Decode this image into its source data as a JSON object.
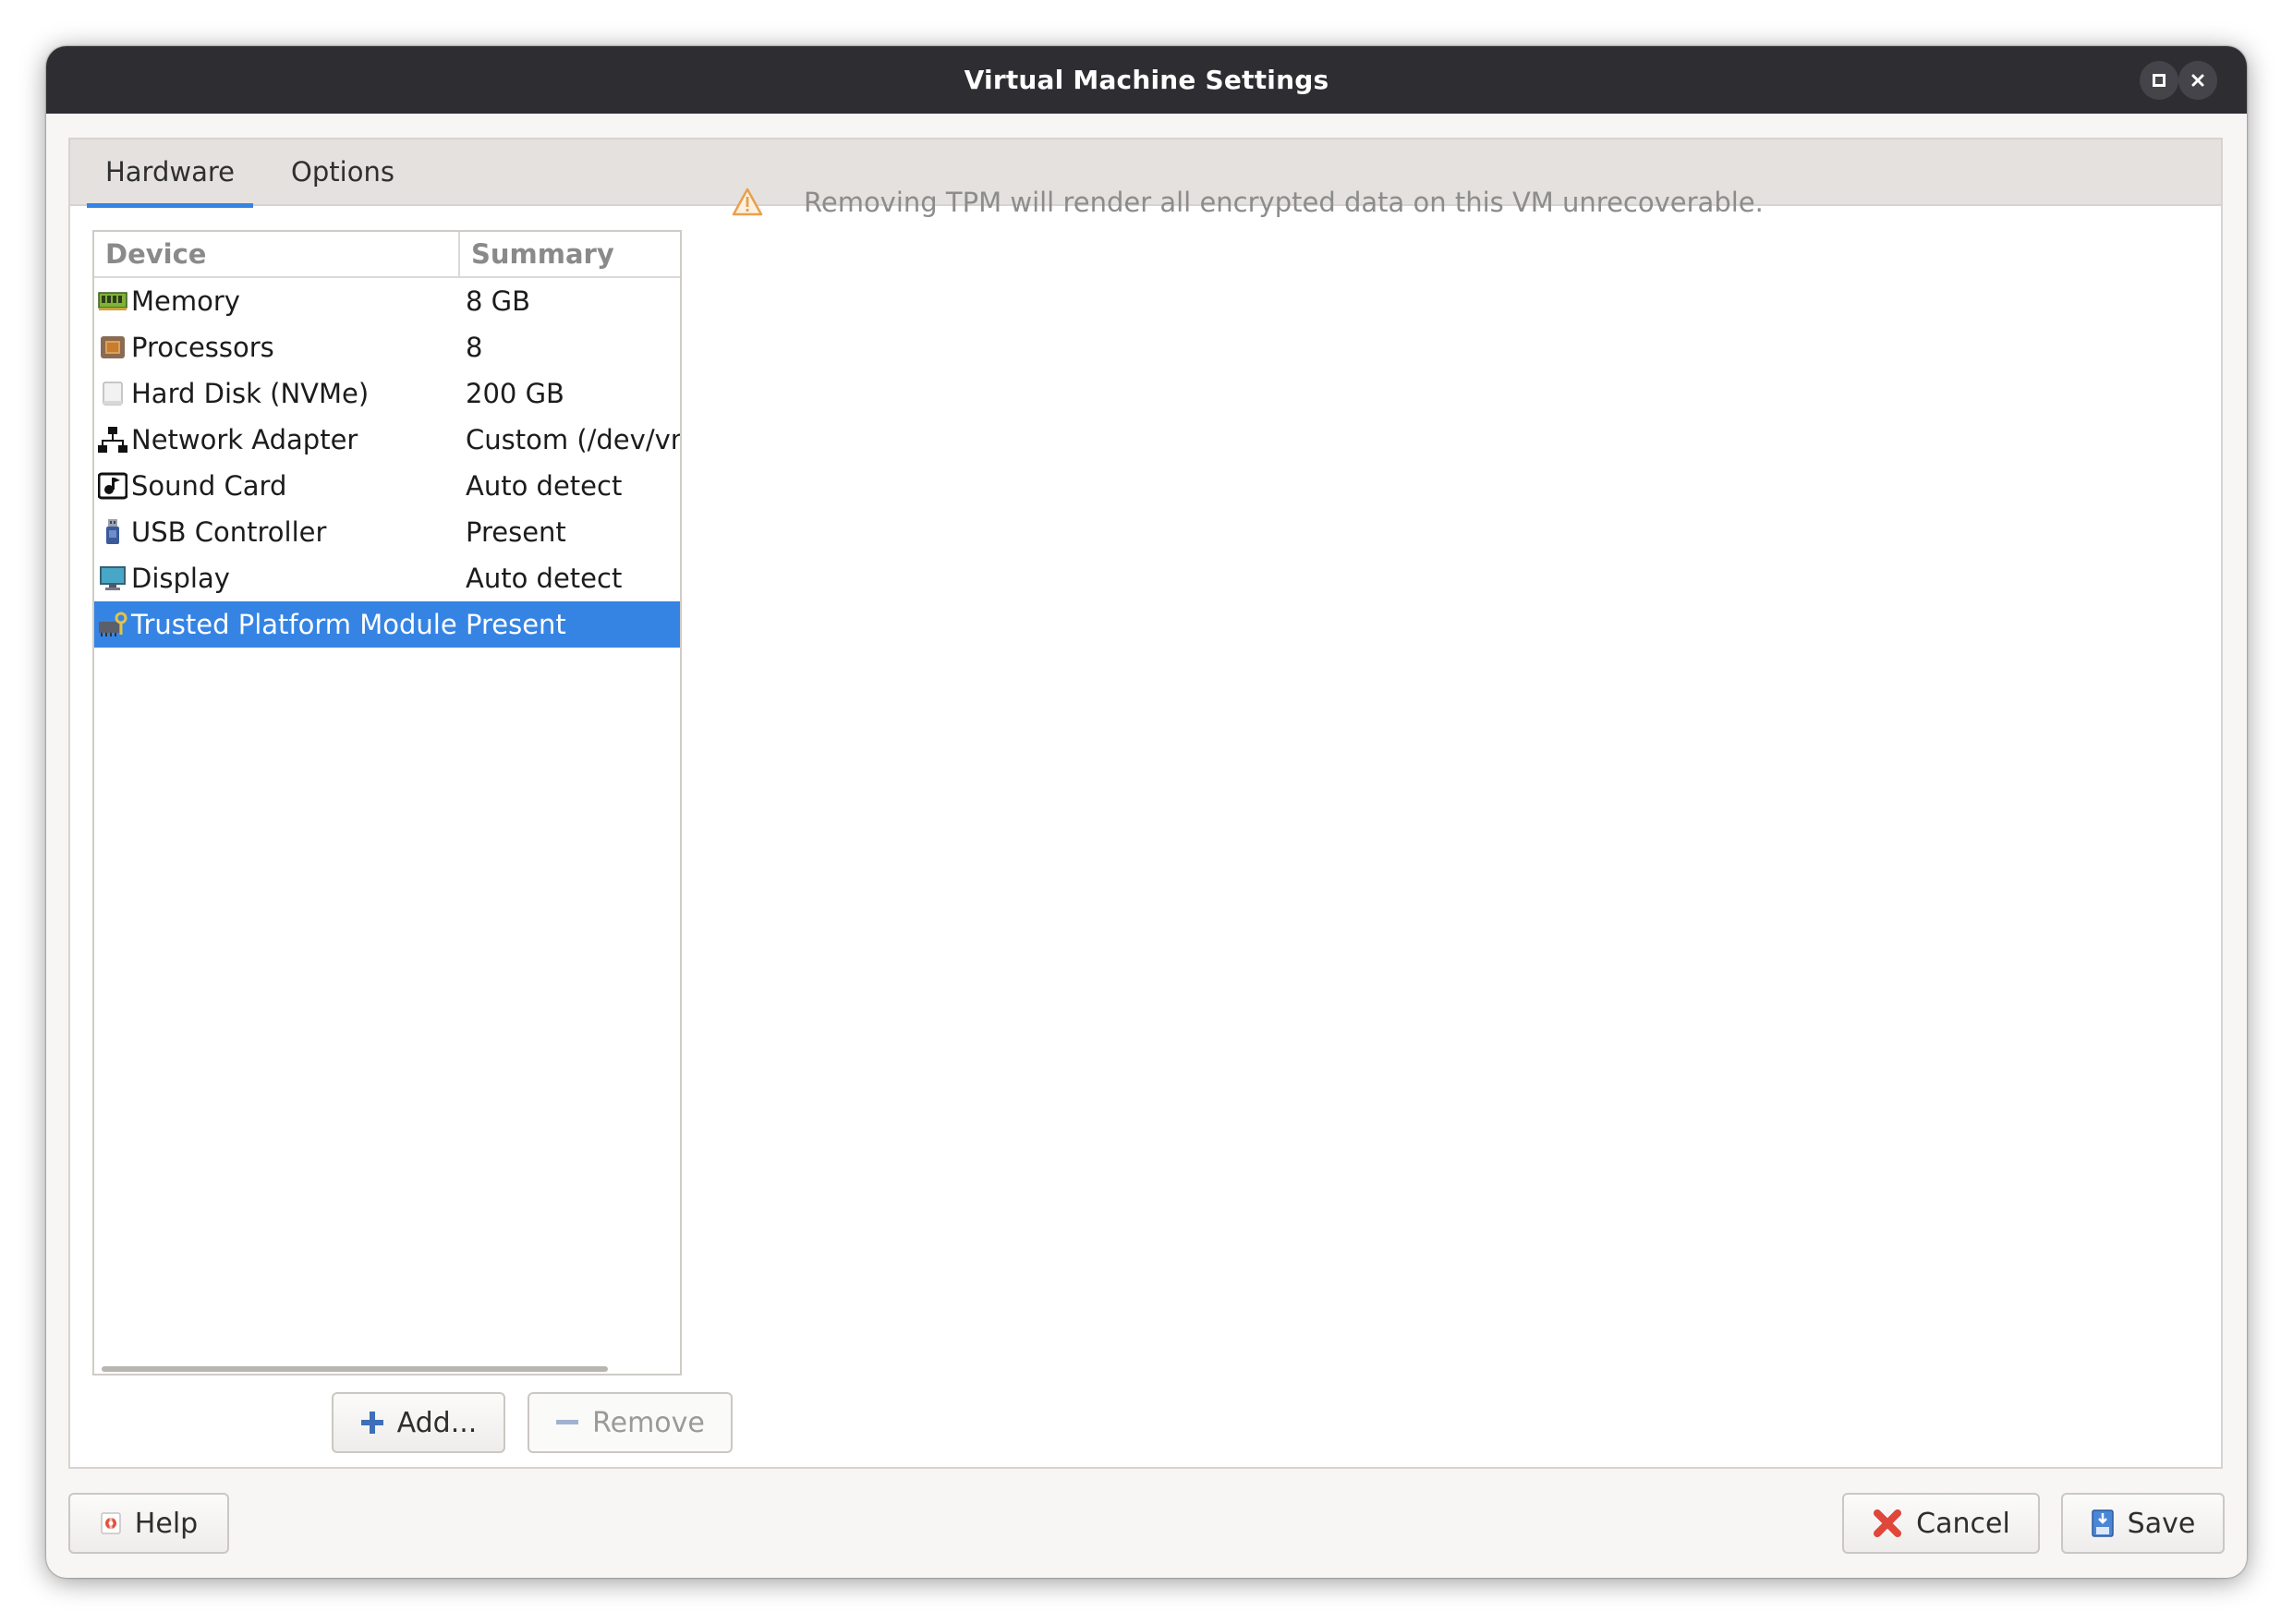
{
  "window": {
    "title": "Virtual Machine Settings"
  },
  "tabs": [
    {
      "label": "Hardware",
      "active": true
    },
    {
      "label": "Options",
      "active": false
    }
  ],
  "device_list": {
    "columns": [
      "Device",
      "Summary"
    ],
    "rows": [
      {
        "icon": "memory-icon",
        "device": "Memory",
        "summary": "8 GB"
      },
      {
        "icon": "processor-icon",
        "device": "Processors",
        "summary": "8"
      },
      {
        "icon": "hard-disk-icon",
        "device": "Hard Disk (NVMe)",
        "summary": "200 GB"
      },
      {
        "icon": "network-icon",
        "device": "Network Adapter",
        "summary": "Custom (/dev/vm"
      },
      {
        "icon": "sound-card-icon",
        "device": "Sound Card",
        "summary": "Auto detect"
      },
      {
        "icon": "usb-icon",
        "device": "USB Controller",
        "summary": "Present"
      },
      {
        "icon": "display-icon",
        "device": "Display",
        "summary": "Auto detect"
      },
      {
        "icon": "tpm-icon",
        "device": "Trusted Platform Module",
        "summary": "Present",
        "selected": true
      }
    ]
  },
  "buttons": {
    "add": "Add...",
    "remove": "Remove",
    "help": "Help",
    "cancel": "Cancel",
    "save": "Save"
  },
  "warning": {
    "text": "Removing TPM will render all encrypted data on this VM unrecoverable."
  },
  "colors": {
    "accent": "#3584e4",
    "titlebar": "#2e2d32",
    "warning": "#e8a04b",
    "cancel": "#e0463a"
  }
}
